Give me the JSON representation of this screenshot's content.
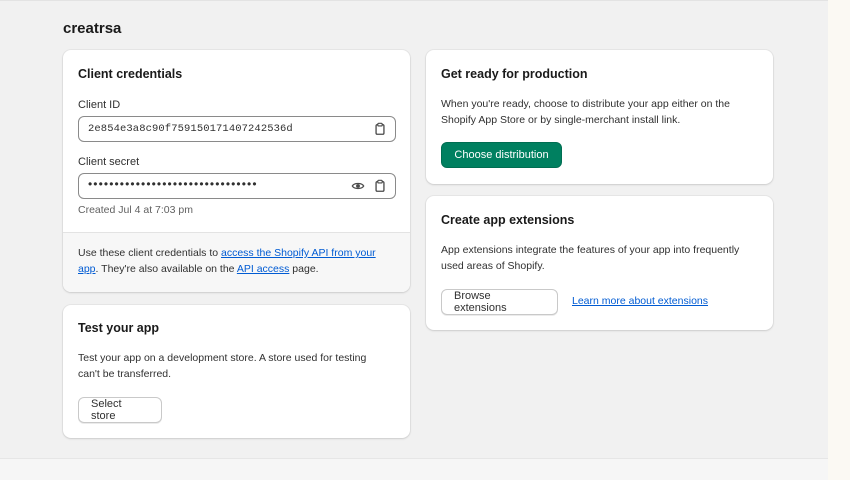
{
  "store_name": "creatrsa",
  "client_credentials": {
    "title": "Client credentials",
    "client_id_label": "Client ID",
    "client_id_value": "2e854e3a8c90f759150171407242536d",
    "client_secret_label": "Client secret",
    "client_secret_masked": "••••••••••••••••••••••••••••••••",
    "created_text": "Created Jul 4 at 7:03 pm",
    "footer": {
      "text_before": "Use these client credentials to ",
      "link1": "access the Shopify API from your app",
      "text_middle": ". They're also available on the ",
      "link2": "API access",
      "text_after": " page."
    }
  },
  "test_app": {
    "title": "Test your app",
    "description": "Test your app on a development store. A store used for testing can't be transferred.",
    "button": "Select store"
  },
  "production": {
    "title": "Get ready for production",
    "description": "When you're ready, choose to distribute your app either on the Shopify App Store or by single-merchant install link.",
    "button": "Choose distribution"
  },
  "extensions": {
    "title": "Create app extensions",
    "description": "App extensions integrate the features of your app into frequently used areas of Shopify.",
    "button": "Browse extensions",
    "link": "Learn more about extensions"
  },
  "icons": {
    "copy": "clipboard-icon",
    "reveal": "eye-icon"
  },
  "colors": {
    "primary_button": "#008060",
    "link": "#005bd3",
    "page_background": "#f1f1f1"
  }
}
